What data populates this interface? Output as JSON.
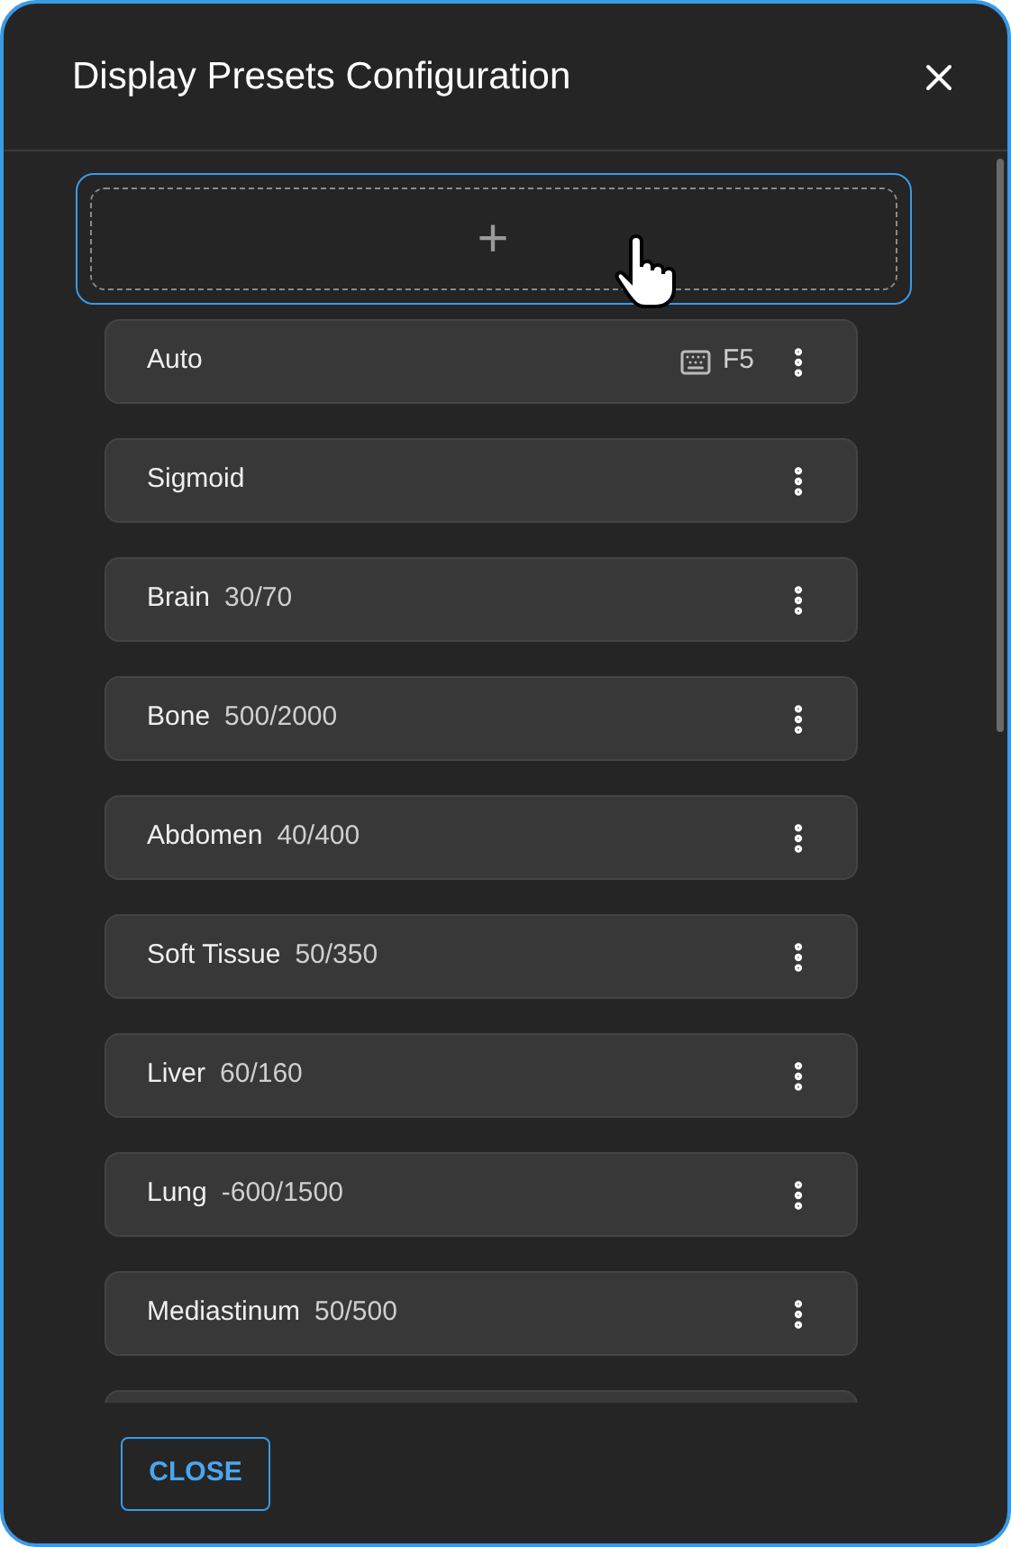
{
  "dialog": {
    "title": "Display Presets Configuration"
  },
  "add_button": {
    "label": "+"
  },
  "presets": [
    {
      "name": "Auto",
      "shortcut": "F5"
    },
    {
      "name": "Sigmoid"
    },
    {
      "name": "Brain",
      "value": "30/70"
    },
    {
      "name": "Bone",
      "value": "500/2000"
    },
    {
      "name": "Abdomen",
      "value": "40/400"
    },
    {
      "name": "Soft Tissue",
      "value": "50/350"
    },
    {
      "name": "Liver",
      "value": "60/160"
    },
    {
      "name": "Lung",
      "value": "-600/1500"
    },
    {
      "name": "Mediastinum",
      "value": "50/500"
    }
  ],
  "footer": {
    "close_label": "CLOSE"
  }
}
